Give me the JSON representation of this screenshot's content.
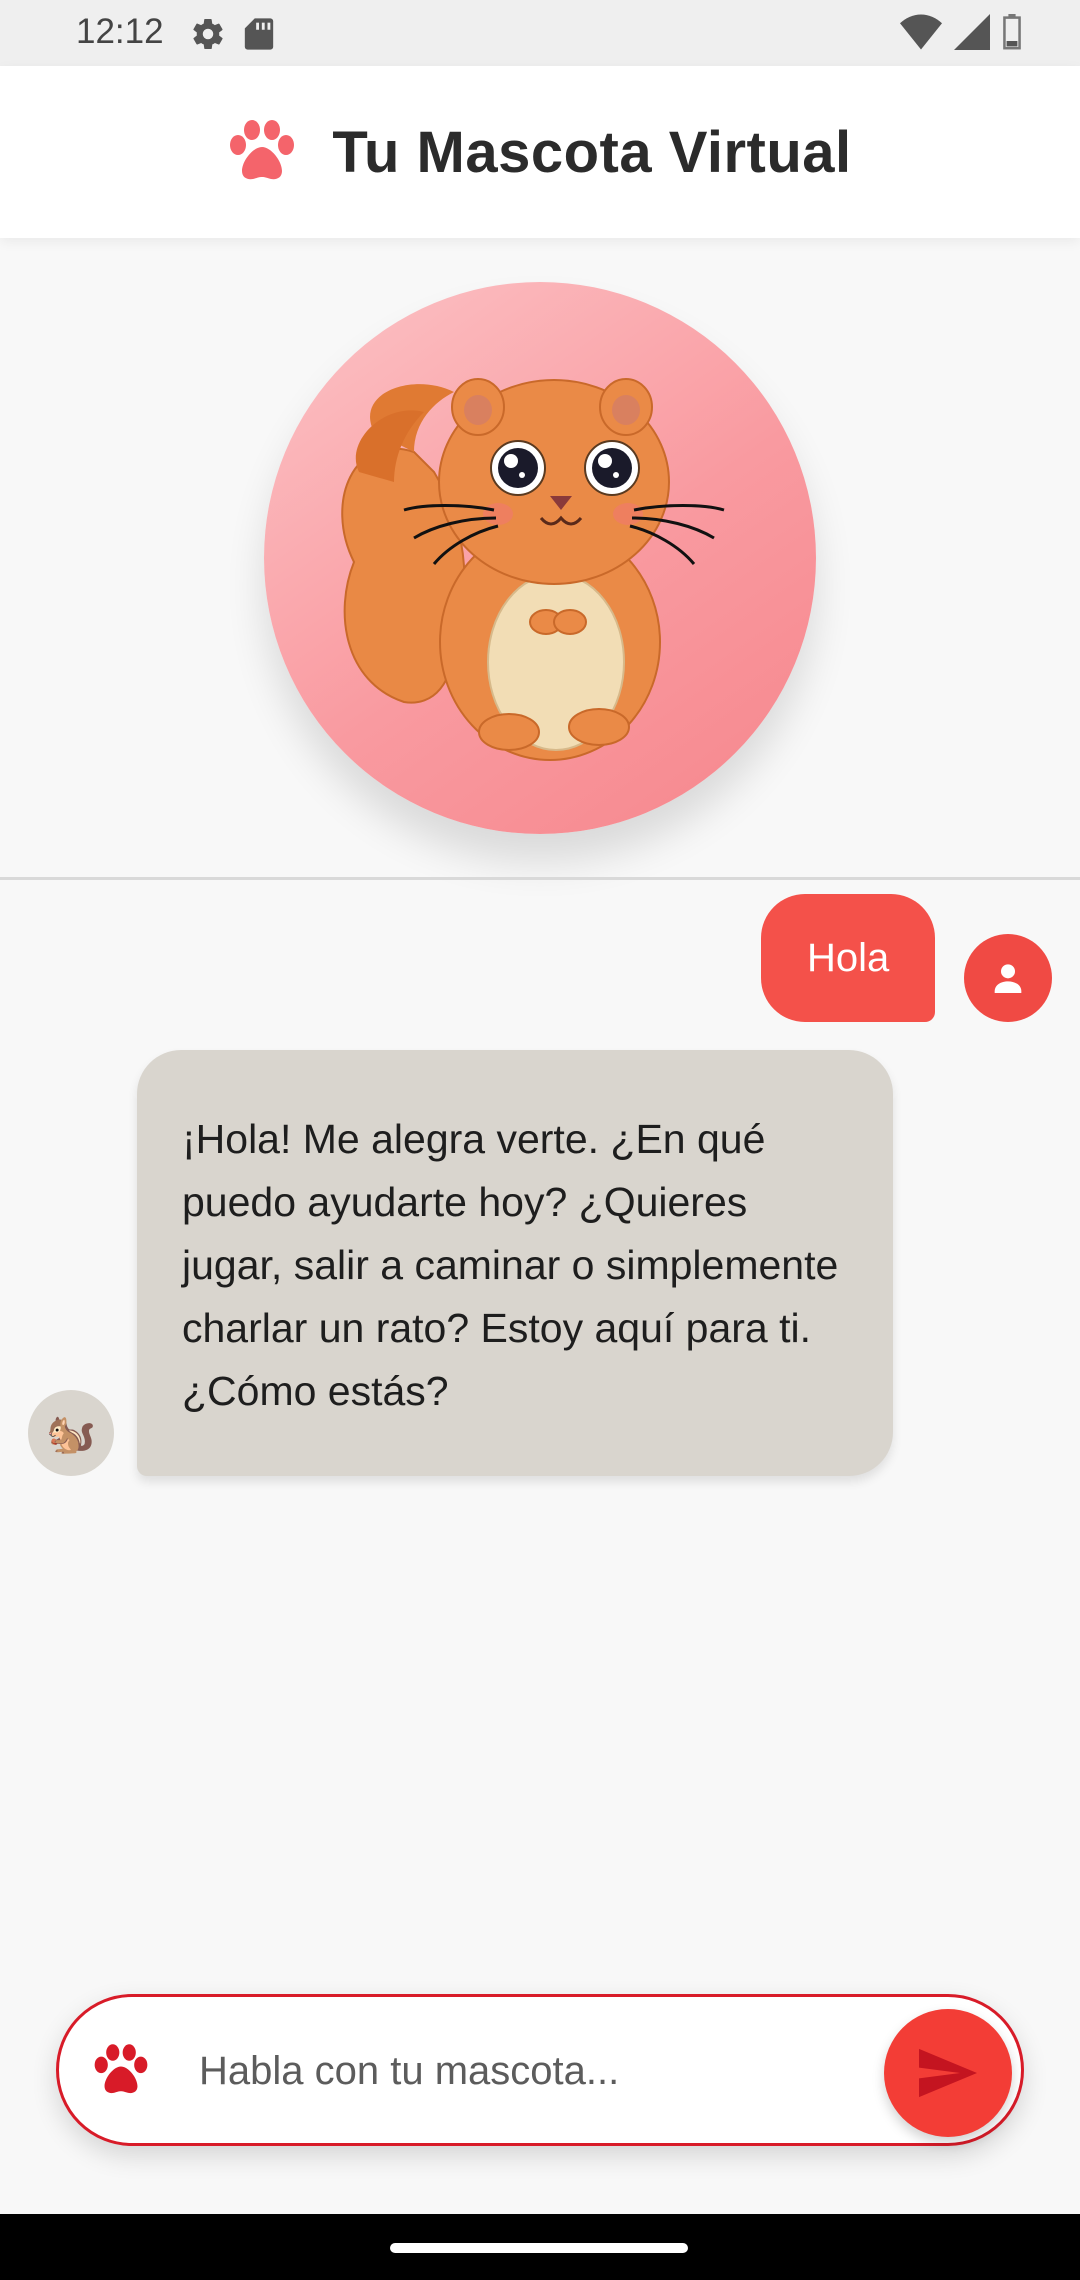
{
  "status_bar": {
    "time": "12:12",
    "left_icons": [
      "settings-icon",
      "sd-card-icon"
    ],
    "right_icons": [
      "wifi-icon",
      "signal-icon",
      "battery-icon"
    ]
  },
  "app_bar": {
    "title": "Tu Mascota Virtual",
    "icon": "paw-icon",
    "accent_color": "#f4646b"
  },
  "pet": {
    "image": "squirrel-illustration",
    "background_gradient": [
      "#fcc4c7",
      "#f6868c"
    ]
  },
  "chat": {
    "messages": [
      {
        "sender": "user",
        "text": "Hola"
      },
      {
        "sender": "pet",
        "text": "¡Hola! Me alegra verte. ¿En qué puedo ayudarte hoy? ¿Quieres jugar, salir a caminar o simplemente charlar un rato? Estoy aquí para ti. ¿Cómo estás?"
      }
    ],
    "pet_avatar_emoji": "🐿️",
    "user_bubble_color": "#f4514a",
    "pet_bubble_color": "#d9d5ce"
  },
  "input": {
    "placeholder": "Habla con tu mascota...",
    "value": "",
    "send_icon": "send-icon",
    "border_color": "#d81b28"
  }
}
